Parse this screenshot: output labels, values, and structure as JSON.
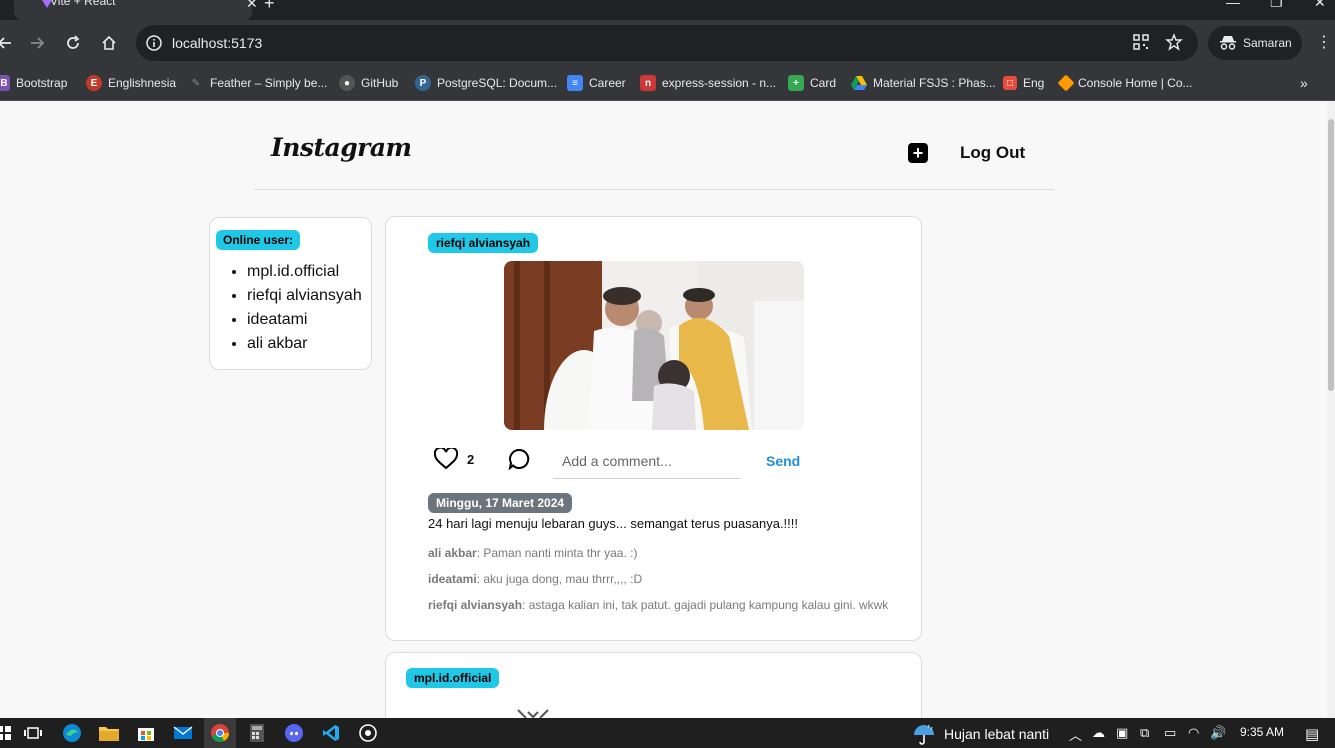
{
  "browser": {
    "tab_title": "Vite + React",
    "url": "localhost:5173",
    "profile_name": "Samaran",
    "bookmarks": [
      {
        "label": "Bootstrap",
        "icon": "bootstrap-icon",
        "color": "#7952b3"
      },
      {
        "label": "Englishnesia",
        "icon": "englishnesia-icon",
        "color": "#c0392b"
      },
      {
        "label": "Feather – Simply be...",
        "icon": "feather-icon",
        "color": "#555555"
      },
      {
        "label": "GitHub",
        "icon": "github-icon",
        "color": "#e8eaed"
      },
      {
        "label": "PostgreSQL: Docum...",
        "icon": "postgresql-icon",
        "color": "#336791"
      },
      {
        "label": "Career",
        "icon": "career-icon",
        "color": "#4285f4"
      },
      {
        "label": "express-session - n...",
        "icon": "npm-icon",
        "color": "#cb3837"
      },
      {
        "label": "Card",
        "icon": "card-icon",
        "color": "#34a853"
      },
      {
        "label": "Material FSJS : Phas...",
        "icon": "google-drive-icon",
        "color": "#fbbc04"
      },
      {
        "label": "Eng",
        "icon": "eng-icon",
        "color": "#e74c3c"
      },
      {
        "label": "Console Home | Co...",
        "icon": "aws-icon",
        "color": "#ff9900"
      }
    ]
  },
  "app": {
    "logo": "Instagram",
    "logout_label": "Log Out",
    "add_icon": "plus-square-icon"
  },
  "online": {
    "title": "Online user:",
    "users": [
      "mpl.id.official",
      "riefqi alviansyah",
      "ideatami",
      "ali akbar"
    ]
  },
  "posts": [
    {
      "author": "riefqi alviansyah",
      "likes": "2",
      "comment_placeholder": "Add a comment...",
      "send_label": "Send",
      "date": "Minggu, 17 Maret 2024",
      "caption": "24 hari lagi menuju lebaran guys... semangat terus puasanya.!!!!",
      "comments": [
        {
          "user": "ali akbar",
          "text": ": Paman nanti minta thr yaa. :)"
        },
        {
          "user": "ideatami",
          "text": ": aku juga dong, mau thrrr,,,, :D"
        },
        {
          "user": "riefqi alviansyah",
          "text": ": astaga kalian ini, tak patut. gajadi pulang kampung kalau gini. wkwk"
        }
      ]
    },
    {
      "author": "mpl.id.official"
    }
  ],
  "taskbar": {
    "weather": "Hujan lebat nanti",
    "time": "9:35 AM"
  }
}
